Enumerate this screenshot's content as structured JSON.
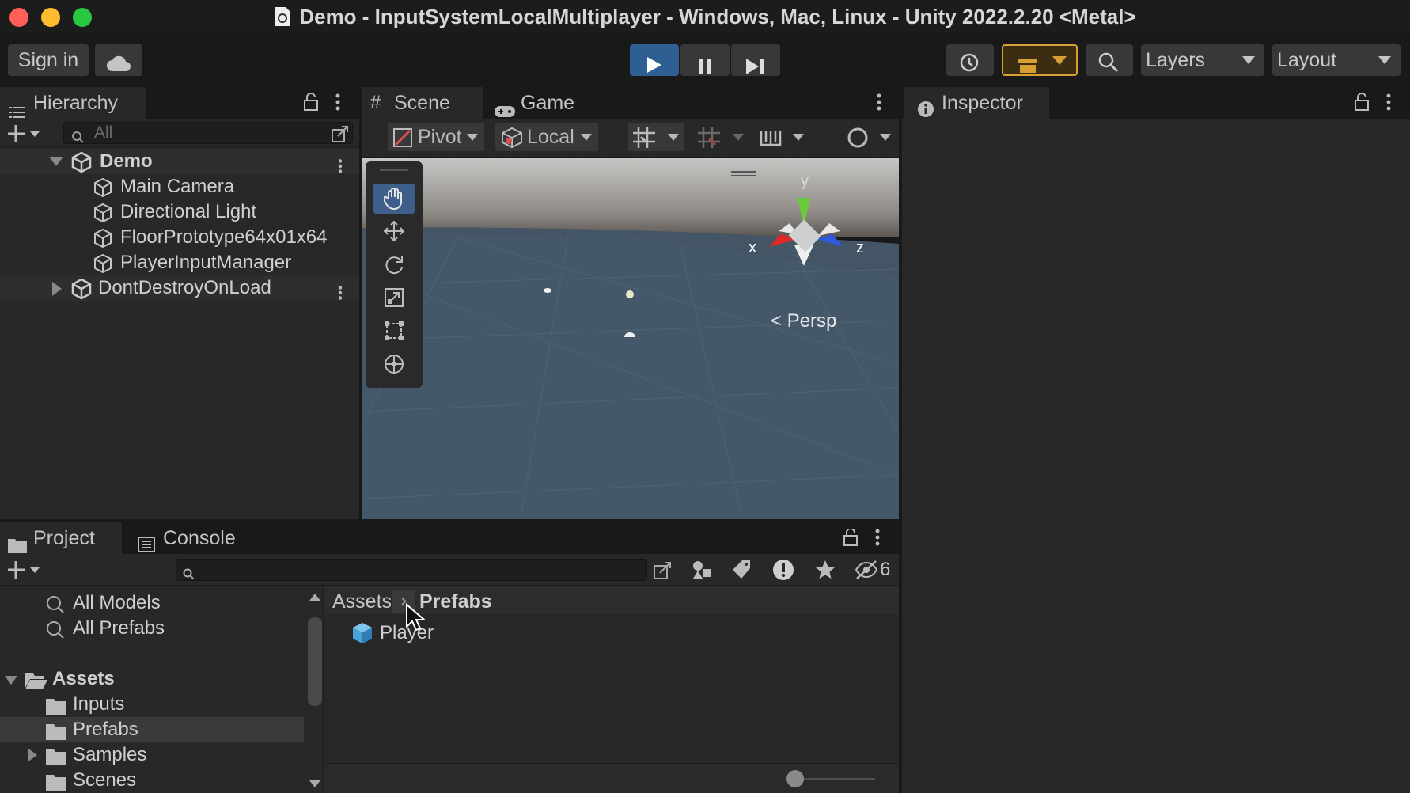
{
  "window": {
    "title": "Demo - InputSystemLocalMultiplayer - Windows, Mac, Linux - Unity 2022.2.20 <Metal>"
  },
  "toolbar": {
    "sign_in": "Sign in",
    "layers": "Layers",
    "layout": "Layout"
  },
  "hierarchy": {
    "tab_label": "Hierarchy",
    "search_placeholder": "All",
    "items": [
      {
        "label": "Demo"
      },
      {
        "label": "Main Camera"
      },
      {
        "label": "Directional Light"
      },
      {
        "label": "FloorPrototype64x01x64"
      },
      {
        "label": "PlayerInputManager"
      },
      {
        "label": "DontDestroyOnLoad"
      }
    ]
  },
  "scene_view": {
    "tabs": [
      {
        "label": "Scene"
      },
      {
        "label": "Game"
      }
    ],
    "pivot": "Pivot",
    "local": "Local",
    "gizmo_axes": {
      "x": "x",
      "y": "y",
      "z": "z"
    },
    "projection": "Persp"
  },
  "inspector": {
    "tab_label": "Inspector"
  },
  "project": {
    "tabs": [
      {
        "label": "Project"
      },
      {
        "label": "Console"
      }
    ],
    "hidden_count": "6",
    "favorites": [
      {
        "label": "All Models"
      },
      {
        "label": "All Prefabs"
      }
    ],
    "tree": [
      {
        "label": "Assets"
      },
      {
        "label": "Inputs"
      },
      {
        "label": "Prefabs"
      },
      {
        "label": "Samples"
      },
      {
        "label": "Scenes"
      }
    ],
    "breadcrumb": [
      "Assets",
      "Prefabs"
    ],
    "assets": [
      {
        "label": "Player"
      }
    ]
  },
  "colors": {
    "accent_blue": "#3f6fae",
    "play_button": "#2d5f93",
    "collab_orange": "#d8a034"
  }
}
